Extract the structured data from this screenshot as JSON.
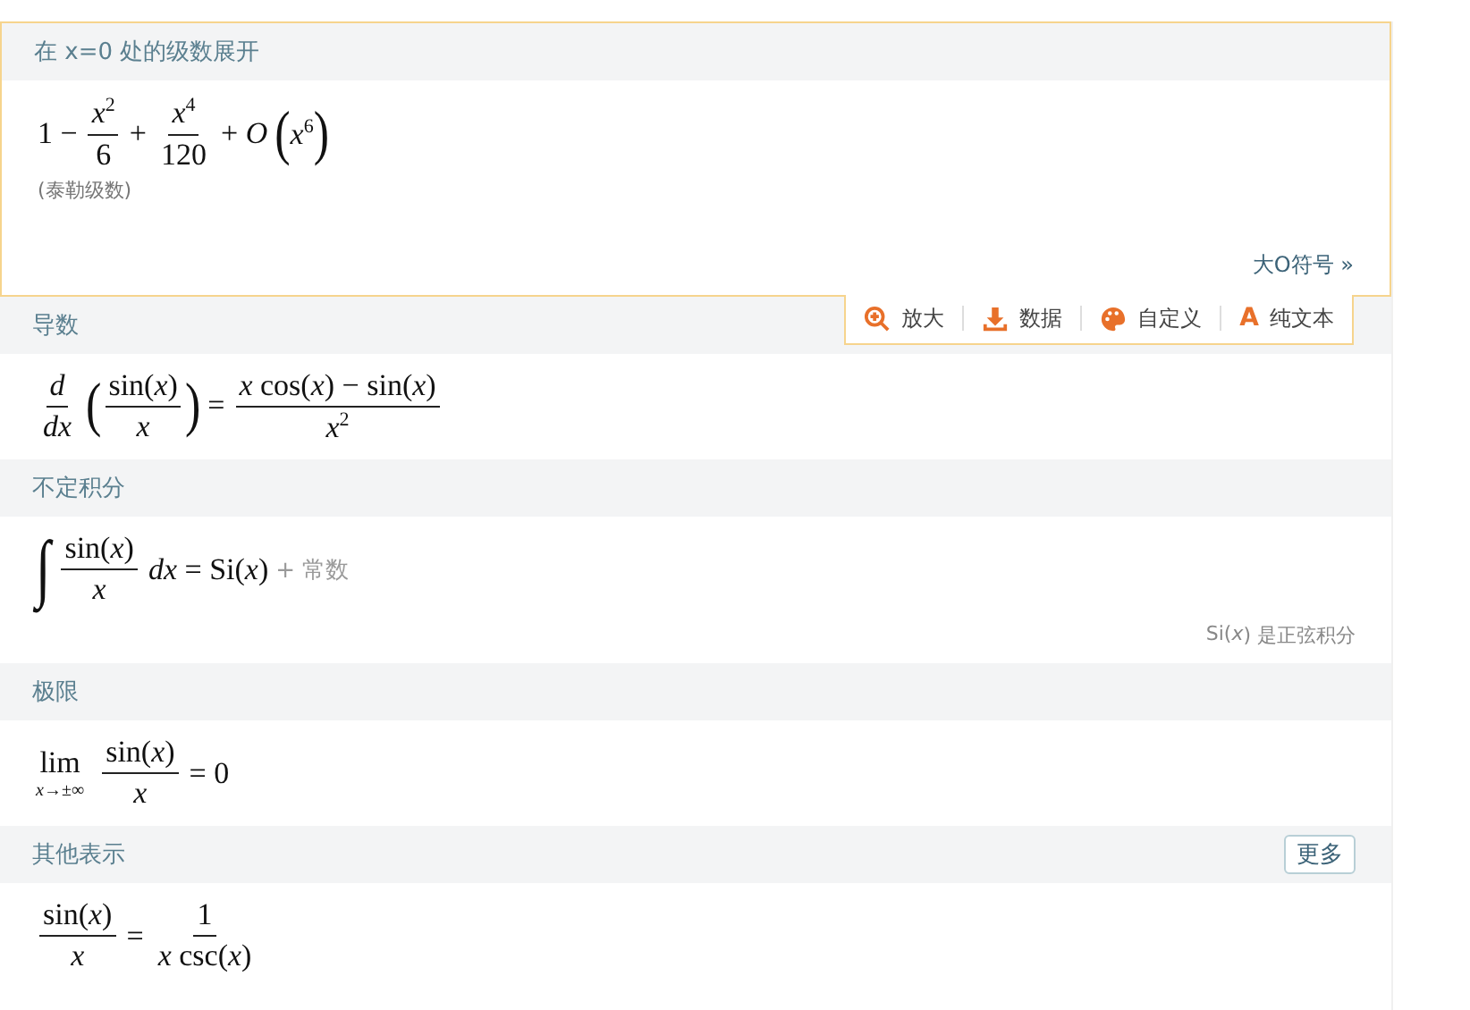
{
  "pods": [
    {
      "title": "在 x=0 处的级数展开",
      "selected": true,
      "formula": [
        {
          "kind": "text",
          "text": "1 −"
        },
        {
          "kind": "frac",
          "num": [
            {
              "kind": "sup",
              "text": "*x*",
              "sup": "2"
            }
          ],
          "den": [
            {
              "kind": "text",
              "text": "6"
            }
          ]
        },
        {
          "kind": "text",
          "text": "+"
        },
        {
          "kind": "frac",
          "num": [
            {
              "kind": "sup",
              "text": "*x*",
              "sup": "4"
            }
          ],
          "den": [
            {
              "kind": "text",
              "text": "120"
            }
          ]
        },
        {
          "kind": "text",
          "text": "+ *O*"
        },
        {
          "kind": "paren",
          "open": "(",
          "close": ")",
          "body": [
            {
              "kind": "sup",
              "text": "*x*",
              "sup": "6"
            }
          ]
        }
      ],
      "note": "(泰勒级数)",
      "link": "大O符号 »"
    },
    {
      "title": "导数",
      "selected": false,
      "formula": [
        {
          "kind": "frac",
          "num": [
            {
              "kind": "text",
              "text": "*d*"
            }
          ],
          "den": [
            {
              "kind": "text",
              "text": "*dx*"
            }
          ]
        },
        {
          "kind": "paren",
          "open": "(",
          "close": ")",
          "body": [
            {
              "kind": "frac",
              "num": [
                {
                  "kind": "text",
                  "text": "sin(*x*)"
                }
              ],
              "den": [
                {
                  "kind": "text",
                  "text": "*x*"
                }
              ]
            }
          ]
        },
        {
          "kind": "text",
          "text": "="
        },
        {
          "kind": "frac",
          "num": [
            {
              "kind": "text",
              "text": "*x* cos(*x*) − sin(*x*)"
            }
          ],
          "den": [
            {
              "kind": "sup",
              "text": "*x*",
              "sup": "2"
            }
          ]
        }
      ]
    },
    {
      "title": "不定积分",
      "selected": false,
      "formula": [
        {
          "kind": "int",
          "text": "∫"
        },
        {
          "kind": "frac",
          "num": [
            {
              "kind": "text",
              "text": "sin(*x*)"
            }
          ],
          "den": [
            {
              "kind": "text",
              "text": "*x*"
            }
          ]
        },
        {
          "kind": "text",
          "text": "*dx* = Si(*x*)"
        },
        {
          "kind": "muted",
          "text": "+ 常数"
        }
      ],
      "footnote": "Si(*x*) 是正弦积分"
    },
    {
      "title": "极限",
      "selected": false,
      "formula": [
        {
          "kind": "lim",
          "text": "lim",
          "sub": "*x*→±∞"
        },
        {
          "kind": "frac",
          "num": [
            {
              "kind": "text",
              "text": "sin(*x*)"
            }
          ],
          "den": [
            {
              "kind": "text",
              "text": "*x*"
            }
          ]
        },
        {
          "kind": "text",
          "text": "= 0"
        }
      ]
    },
    {
      "title": "其他表示",
      "selected": false,
      "button": "更多",
      "formula": [
        {
          "kind": "frac",
          "num": [
            {
              "kind": "text",
              "text": "sin(*x*)"
            }
          ],
          "den": [
            {
              "kind": "text",
              "text": "*x*"
            }
          ]
        },
        {
          "kind": "text",
          "text": "="
        },
        {
          "kind": "frac",
          "num": [
            {
              "kind": "text",
              "text": "1"
            }
          ],
          "den": [
            {
              "kind": "text",
              "text": "*x* csc(*x*)"
            }
          ]
        }
      ]
    }
  ],
  "toolbar": [
    {
      "kind": "zoom",
      "label": "放大"
    },
    {
      "kind": "download",
      "label": "数据"
    },
    {
      "kind": "palette",
      "label": "自定义"
    },
    {
      "kind": "letter",
      "glyph": "A",
      "label": "纯文本"
    }
  ]
}
